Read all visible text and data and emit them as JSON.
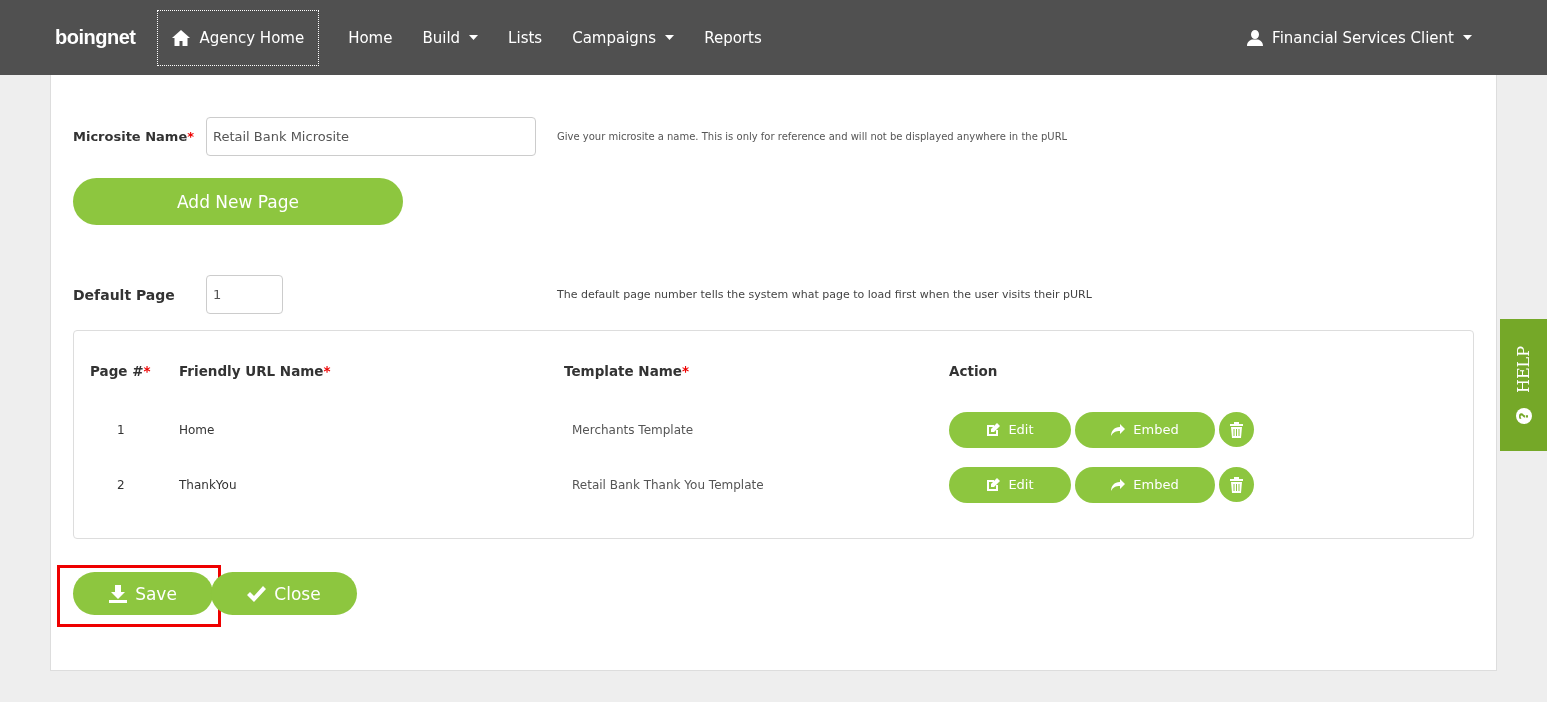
{
  "navbar": {
    "logo": "boingnet",
    "items": [
      {
        "label": "Agency Home",
        "selected": true,
        "dropdown": false
      },
      {
        "label": "Home",
        "selected": false,
        "dropdown": false
      },
      {
        "label": "Build",
        "selected": false,
        "dropdown": true
      },
      {
        "label": "Lists",
        "selected": false,
        "dropdown": false
      },
      {
        "label": "Campaigns",
        "selected": false,
        "dropdown": true
      },
      {
        "label": "Reports",
        "selected": false,
        "dropdown": false
      }
    ],
    "user": {
      "label": "Financial Services Client",
      "dropdown": true
    }
  },
  "form": {
    "microsite_name": {
      "label": "Microsite Name",
      "required_mark": "*",
      "value": "Retail Bank Microsite",
      "hint": "Give your microsite a name. This is only for reference and will not be displayed anywhere in the pURL"
    },
    "add_page_button": "Add New Page",
    "default_page": {
      "label": "Default Page",
      "value": "1",
      "hint": "The default page number tells the system what page to load first when the user visits their pURL"
    }
  },
  "table": {
    "columns": [
      {
        "label": "Page #",
        "required_mark": "*"
      },
      {
        "label": "Friendly URL Name",
        "required_mark": "*"
      },
      {
        "label": "Template Name",
        "required_mark": "*"
      },
      {
        "label": "Action"
      }
    ],
    "rows": [
      {
        "page": "1",
        "friendly_url": "Home",
        "template": "Merchants Template",
        "edit": "Edit",
        "embed": "Embed"
      },
      {
        "page": "2",
        "friendly_url": "ThankYou",
        "template": "Retail Bank Thank You Template",
        "edit": "Edit",
        "embed": "Embed"
      }
    ]
  },
  "footer_buttons": [
    {
      "label": "Save",
      "highlighted": true
    },
    {
      "label": "Close",
      "highlighted": false
    }
  ],
  "help_tab": {
    "label": "HELP",
    "icon_glyph": "?"
  }
}
